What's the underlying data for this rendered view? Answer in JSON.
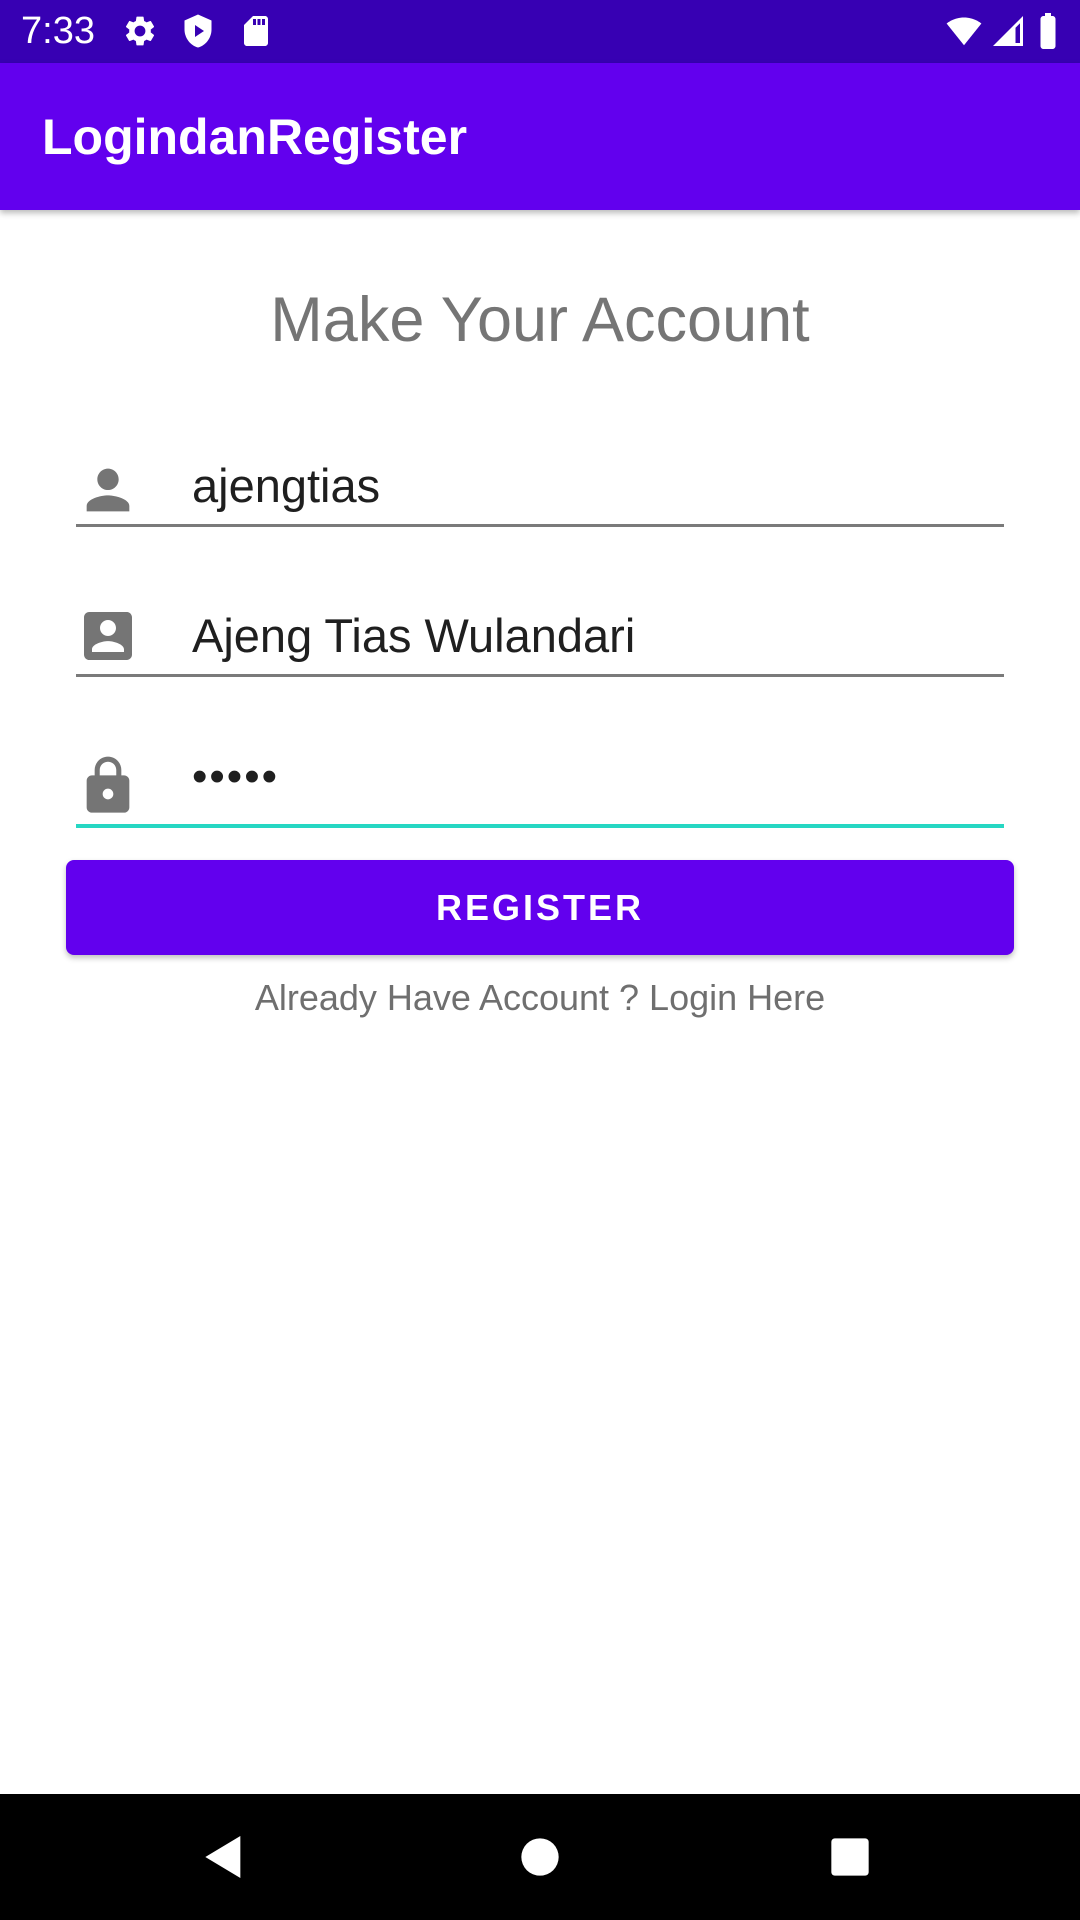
{
  "status_bar": {
    "time": "7:33",
    "icons": [
      "gear-icon",
      "shield-play-icon",
      "sd-card-icon",
      "wifi-icon",
      "signal-icon",
      "battery-icon"
    ]
  },
  "app_bar": {
    "title": "LogindanRegister"
  },
  "form": {
    "heading": "Make Your Account",
    "username": {
      "icon": "person-icon",
      "value": "ajengtias"
    },
    "fullname": {
      "icon": "account-box-icon",
      "value": "Ajeng Tias Wulandari"
    },
    "password": {
      "icon": "lock-icon",
      "value": "•••••"
    },
    "register_label": "REGISTER",
    "login_link": "Already Have Account ? Login Here"
  },
  "colors": {
    "status_bar": "#3700b3",
    "primary": "#6200ee",
    "focus_accent": "#26d7c3",
    "icon_gray": "#757575"
  },
  "nav_bar": {
    "icons": [
      "back-icon",
      "home-icon",
      "recents-icon"
    ]
  }
}
